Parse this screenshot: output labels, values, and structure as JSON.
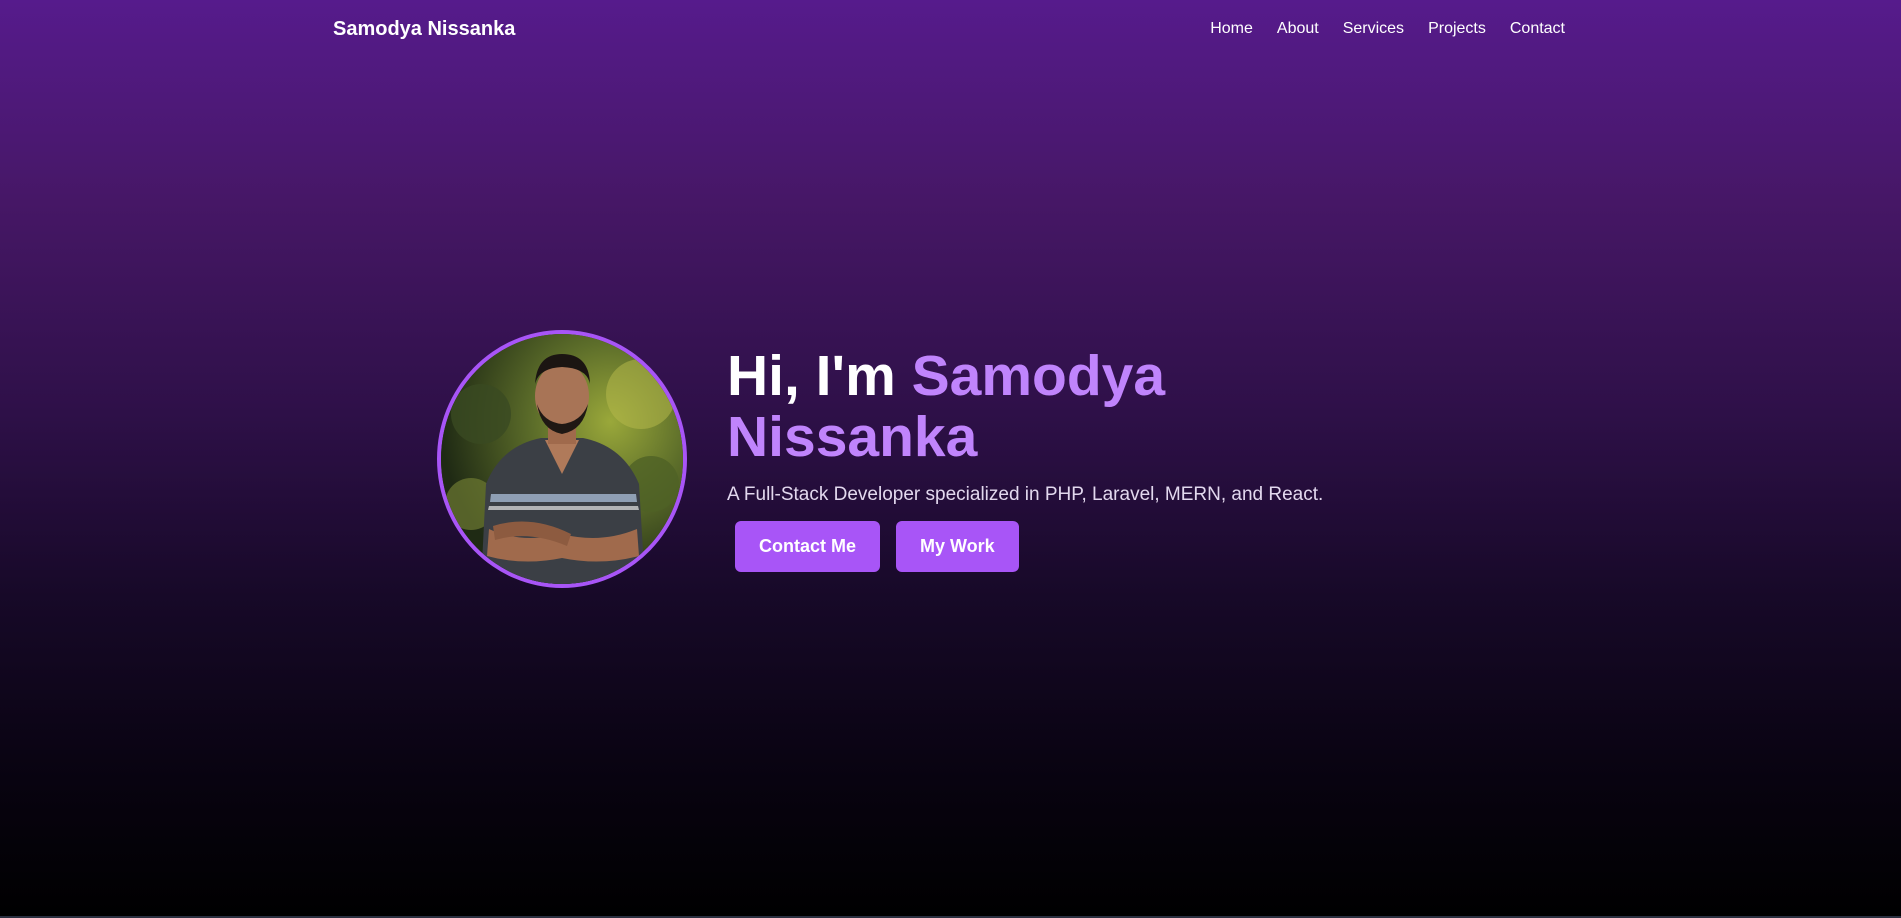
{
  "nav": {
    "brand": "Samodya Nissanka",
    "links": [
      "Home",
      "About",
      "Services",
      "Projects",
      "Contact"
    ]
  },
  "hero": {
    "greeting": "Hi, I'm ",
    "first_name": "Samodya",
    "last_name": "Nissanka",
    "tagline": "A Full-Stack Developer specialized in PHP, Laravel, MERN, and React.",
    "primary_button": "Contact Me",
    "secondary_button": "My Work"
  },
  "colors": {
    "accent": "#a855f7",
    "accent_text": "#c084fc",
    "background_top": "#561b8c",
    "background_bottom": "#000000"
  }
}
